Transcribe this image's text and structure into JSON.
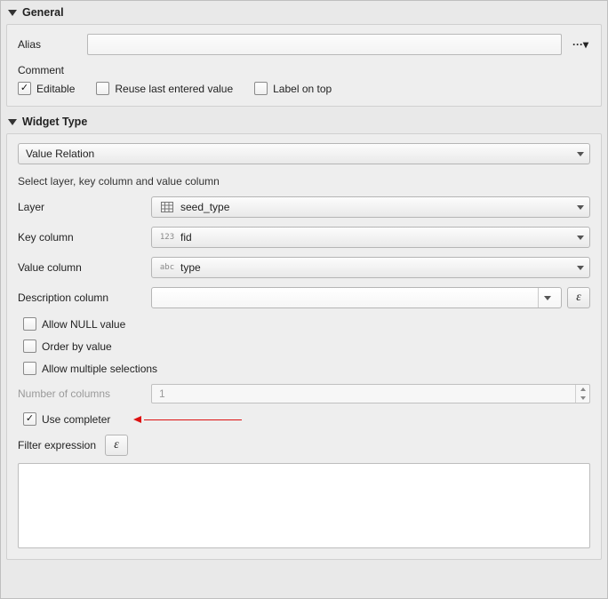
{
  "general": {
    "title": "General",
    "alias_label": "Alias",
    "alias_value": "",
    "comment_label": "Comment",
    "editable": {
      "label": "Editable",
      "checked": true
    },
    "reuse_last": {
      "label": "Reuse last entered value",
      "checked": false
    },
    "label_on_top": {
      "label": "Label on top",
      "checked": false
    }
  },
  "widget": {
    "title": "Widget Type",
    "type_value": "Value Relation",
    "hint": "Select layer, key column and value column",
    "layer": {
      "label": "Layer",
      "value": "seed_type",
      "icon": "table-icon"
    },
    "key_column": {
      "label": "Key column",
      "value": "fid",
      "prefix": "123"
    },
    "value_column": {
      "label": "Value column",
      "value": "type",
      "prefix": "abc"
    },
    "description_column": {
      "label": "Description column",
      "value": ""
    },
    "allow_null": {
      "label": "Allow NULL value",
      "checked": false
    },
    "order_by_value": {
      "label": "Order by value",
      "checked": false
    },
    "allow_multiple": {
      "label": "Allow multiple selections",
      "checked": false
    },
    "num_columns": {
      "label": "Number of columns",
      "value": "1",
      "enabled": false
    },
    "use_completer": {
      "label": "Use completer",
      "checked": true
    },
    "filter_expression": {
      "label": "Filter expression"
    }
  }
}
